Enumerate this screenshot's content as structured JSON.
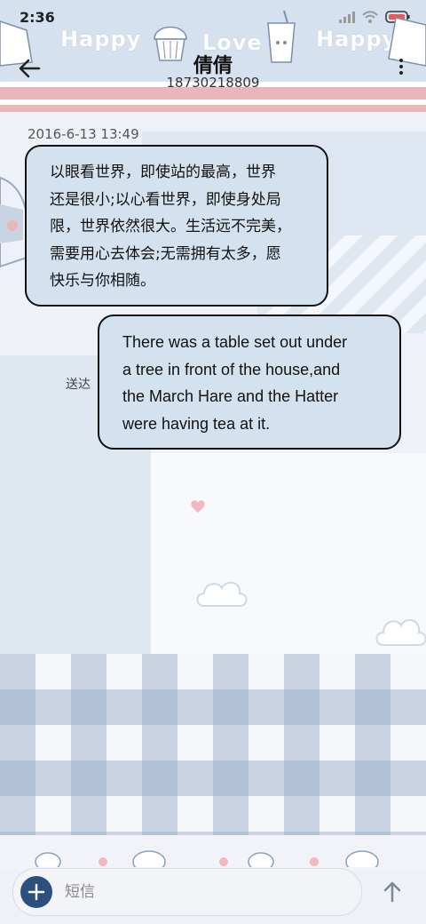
{
  "status_bar": {
    "time": "2:36"
  },
  "header": {
    "decor_words": [
      "Happy",
      "Love",
      "Happy"
    ],
    "title": "倩倩",
    "subtitle": "18730218809"
  },
  "messages": [
    {
      "direction": "incoming",
      "timestamp": "2016-6-13 13:49",
      "lines": [
        "以眼看世界，即使站的最高，世界",
        "还是很小;以心看世界，即使身处局",
        "限，世界依然很大。生活远不完美，",
        "需要用心去体会;无需拥有太多，愿",
        "快乐与你相随。"
      ]
    },
    {
      "direction": "outgoing",
      "status": "送达",
      "lines": [
        "There was a table set out under",
        "a tree in front of the house,and",
        "the March Hare and the Hatter",
        "were having tea at it."
      ]
    }
  ],
  "input": {
    "placeholder": "短信"
  },
  "colors": {
    "header_bg": "#d5e1ee",
    "bubble_bg": "#d4e2f0",
    "accent": "#2b4f7f",
    "stripe_pink": "#e9b6ba"
  }
}
